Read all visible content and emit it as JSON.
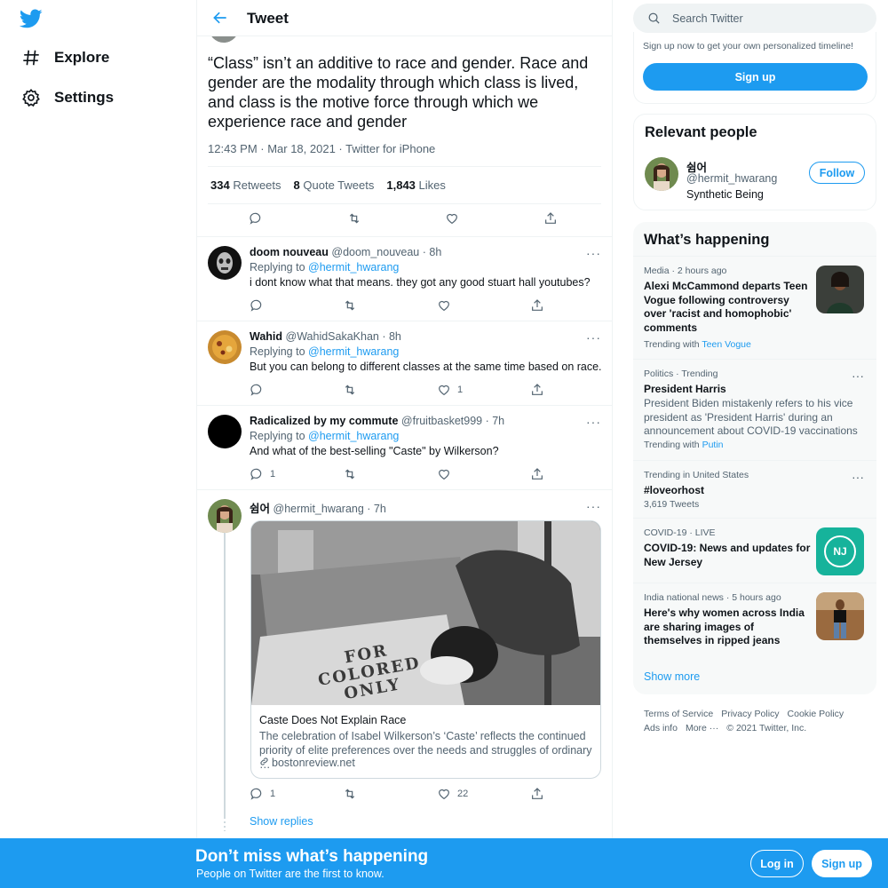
{
  "nav": {
    "items": [
      {
        "label": "Explore",
        "icon": "hashtag-icon"
      },
      {
        "label": "Settings",
        "icon": "gear-icon"
      }
    ]
  },
  "header": {
    "title": "Tweet"
  },
  "main_tweet": {
    "text": "“Class” isn’t an additive to race and gender. Race and gender are the modality through which class is lived, and class is the motive force through which we experience race and gender",
    "meta": "12:43 PM · Mar 18, 2021 · Twitter for iPhone",
    "retweets_count": "334",
    "retweets_label": "Retweets",
    "quotes_count": "8",
    "quotes_label": "Quote Tweets",
    "likes_count": "1,843",
    "likes_label": "Likes"
  },
  "replies": [
    {
      "name": "doom nouveau",
      "handle_time": "@doom_nouveau · 8h",
      "replying_label": "Replying to",
      "replying_to": "@hermit_hwarang",
      "text": "i dont know what that means. they got any good stuart hall youtubes?",
      "reply_count": "",
      "like_count": ""
    },
    {
      "name": "Wahid",
      "handle_time": "@WahidSakaKhan · 8h",
      "replying_label": "Replying to",
      "replying_to": "@hermit_hwarang",
      "text": "But you can belong to different classes at the same time based on race.",
      "reply_count": "",
      "like_count": "1"
    },
    {
      "name": "Radicalized by my commute",
      "handle_time": "@fruitbasket999 · 7h",
      "replying_label": "Replying to",
      "replying_to": "@hermit_hwarang",
      "text": "And what of the best-selling \"Caste\" by Wilkerson?",
      "reply_count": "1",
      "like_count": ""
    },
    {
      "name": "쉼어",
      "handle_time": "@hermit_hwarang · 7h",
      "reply_count": "1",
      "like_count": "22"
    }
  ],
  "card": {
    "title": "Caste Does Not Explain Race",
    "description": "The celebration of Isabel Wilkerson’s ‘Caste’ reflects the continued priority of elite preferences over the needs and struggles of ordinary …",
    "domain": "bostonreview.net",
    "sign_text": "FOR COLORED ONLY"
  },
  "show_replies": "Show replies",
  "search": {
    "placeholder": "Search Twitter"
  },
  "signup_box": {
    "text": "Sign up now to get your own personalized timeline!",
    "button": "Sign up"
  },
  "relevant": {
    "heading": "Relevant people",
    "name": "쉼어",
    "handle": "@hermit_hwarang",
    "bio": "Synthetic Being",
    "follow": "Follow"
  },
  "trends": {
    "heading": "What’s happening",
    "items": [
      {
        "context": "Media · 2 hours ago",
        "title": "Alexi McCammond departs Teen Vogue following controversy over 'racist and homophobic' comments",
        "with_label": "Trending with",
        "with": "Teen Vogue"
      },
      {
        "context": "Politics · Trending",
        "title": "President Harris",
        "desc": "President Biden mistakenly refers to his vice president as 'President Harris' during an announcement about COVID-19 vaccinations",
        "with_label": "Trending with",
        "with": "Putin"
      },
      {
        "context": "Trending in United States",
        "title": "#loveorhost",
        "tweets": "3,619 Tweets"
      },
      {
        "context": "COVID-19 · LIVE",
        "title": "COVID-19: News and updates for New Jersey",
        "badge": "NJ"
      },
      {
        "context": "India national news · 5 hours ago",
        "title": "Here's why women across India are sharing images of themselves in ripped jeans"
      }
    ],
    "show_more": "Show more"
  },
  "footer": {
    "links": [
      "Terms of Service",
      "Privacy Policy",
      "Cookie Policy",
      "Ads info",
      "More ···"
    ],
    "copyright": "© 2021 Twitter, Inc."
  },
  "bottom_bar": {
    "heading": "Don’t miss what’s happening",
    "subtext": "People on Twitter are the first to know.",
    "login": "Log in",
    "signup": "Sign up"
  },
  "colors": {
    "accent": "#1d9bf0",
    "text": "#0f1419",
    "muted": "#536471",
    "border": "#eff3f4"
  }
}
